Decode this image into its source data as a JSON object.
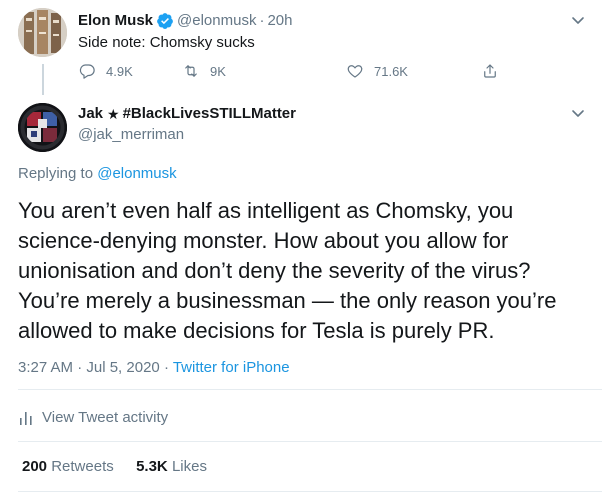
{
  "parent_tweet": {
    "name": "Elon Musk",
    "handle": "@elonmusk",
    "separator": "·",
    "time": "20h",
    "text": "Side note: Chomsky sucks",
    "replies": "4.9K",
    "retweets": "9K",
    "likes": "71.6K",
    "verified": true
  },
  "reply_tweet": {
    "name": "Jak",
    "name_suffix": "#BlackLivesSTILLMatter",
    "handle": "@jak_merriman",
    "replying_prefix": "Replying to",
    "replying_to": "@elonmusk",
    "text_lines": [
      "You aren’t even half as intelligent as Chomsky, you",
      "science-denying monster. How about you allow for",
      "unionisation and don’t deny the severity of the virus?",
      "You’re merely a businessman — the only reason you’re",
      "allowed to make decisions for Tesla is purely PR."
    ],
    "timestamp": "3:27 AM · Jul 5, 2020",
    "meta_separator": "·",
    "source": "Twitter for iPhone",
    "activity_label": "View Tweet activity",
    "retweet_count": "200",
    "retweet_label": "Retweets",
    "like_count": "5.3K",
    "like_label": "Likes"
  },
  "colors": {
    "link": "#1b95e0",
    "secondary_text": "#657786",
    "separator": "#e6ecf0",
    "verified": "#1da1f2"
  },
  "icons": {
    "reply": "speech-bubble-icon",
    "retweet": "retweet-icon",
    "like": "heart-icon",
    "share": "share-icon",
    "caret": "chevron-down-icon",
    "activity": "bar-chart-icon",
    "verified": "verified-badge-icon"
  }
}
